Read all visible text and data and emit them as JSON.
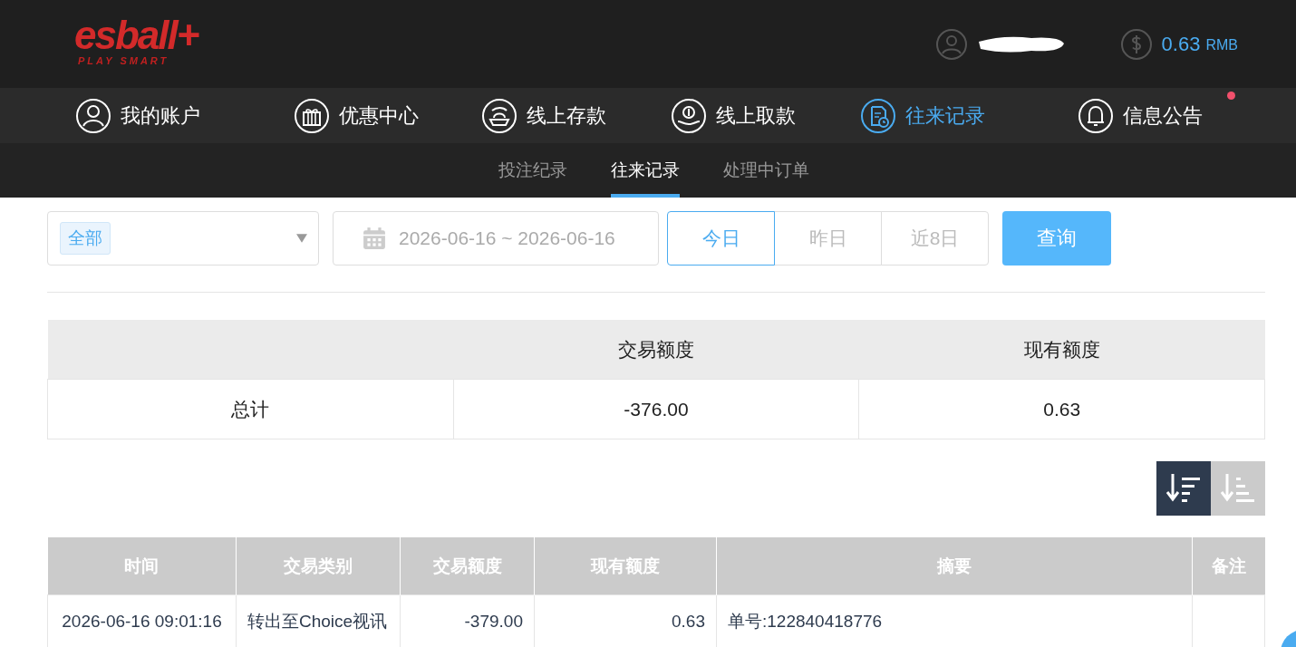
{
  "header": {
    "logo": {
      "name": "esball+",
      "tagline": "PLAY SMART"
    },
    "account": {
      "redacted": true
    },
    "balance": {
      "amount": "0.63",
      "currency": "RMB"
    }
  },
  "nav": [
    {
      "label": "我的账户",
      "kind": "user",
      "selected": false,
      "badge": false
    },
    {
      "label": "优惠中心",
      "kind": "gift",
      "selected": false,
      "badge": false
    },
    {
      "label": "线上存款",
      "kind": "deposit",
      "selected": false,
      "badge": false
    },
    {
      "label": "线上取款",
      "kind": "withdraw",
      "selected": false,
      "badge": false
    },
    {
      "label": "往来记录",
      "kind": "records",
      "selected": true,
      "badge": false
    },
    {
      "label": "信息公告",
      "kind": "bell",
      "selected": false,
      "badge": true
    }
  ],
  "subtabs": [
    {
      "label": "投注纪录",
      "selected": false
    },
    {
      "label": "往来记录",
      "selected": true
    },
    {
      "label": "处理中订单",
      "selected": false
    }
  ],
  "filters": {
    "type_select": {
      "value": "全部"
    },
    "date_range": {
      "value": "2026-06-16 ~ 2026-06-16"
    },
    "quick_ranges": [
      {
        "label": "今日",
        "selected": true
      },
      {
        "label": "昨日",
        "selected": false
      },
      {
        "label": "近8日",
        "selected": false
      }
    ],
    "query_button": "查询"
  },
  "summary": {
    "columns": [
      "交易额度",
      "现有额度"
    ],
    "rows": [
      {
        "label": "总计",
        "amount": "-376.00",
        "balance": "0.63"
      }
    ]
  },
  "sort_buttons": [
    {
      "kind": "desc",
      "selected": true
    },
    {
      "kind": "asc",
      "selected": false
    }
  ],
  "records": {
    "columns": [
      "时间",
      "交易类别",
      "交易额度",
      "现有额度",
      "摘要",
      "备注"
    ],
    "rows": [
      {
        "time": "2026-06-16 09:01:16",
        "type": "转出至Choice视讯",
        "amount": "-379.00",
        "balance": "0.63",
        "summary": "单号:122840418776"
      }
    ]
  }
}
